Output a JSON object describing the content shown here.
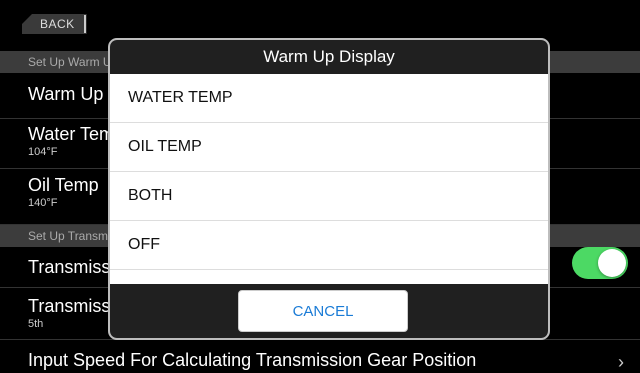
{
  "header": {
    "back_label": "BACK"
  },
  "sections": [
    {
      "title": "Set Up Warm Up"
    },
    {
      "title": "Set Up Transmission"
    }
  ],
  "rows": [
    {
      "label": "Warm Up Display",
      "value": ""
    },
    {
      "label": "Water Temp",
      "value": "104°F"
    },
    {
      "label": "Oil Temp",
      "value": "140°F"
    },
    {
      "label": "Transmission",
      "value": "",
      "toggle": "on"
    },
    {
      "label": "Transmission",
      "value": "5th"
    },
    {
      "label": "Input Speed For Calculating Transmission Gear Position",
      "value": ""
    }
  ],
  "dialog": {
    "title": "Warm Up Display",
    "options": [
      "WATER TEMP",
      "OIL TEMP",
      "BOTH",
      "OFF"
    ],
    "cancel_label": "CANCEL"
  },
  "colors": {
    "toggle_on": "#4cd964",
    "link_blue": "#1a7bd6"
  },
  "icons": {
    "row_disclosure": "chevron-right-icon"
  }
}
